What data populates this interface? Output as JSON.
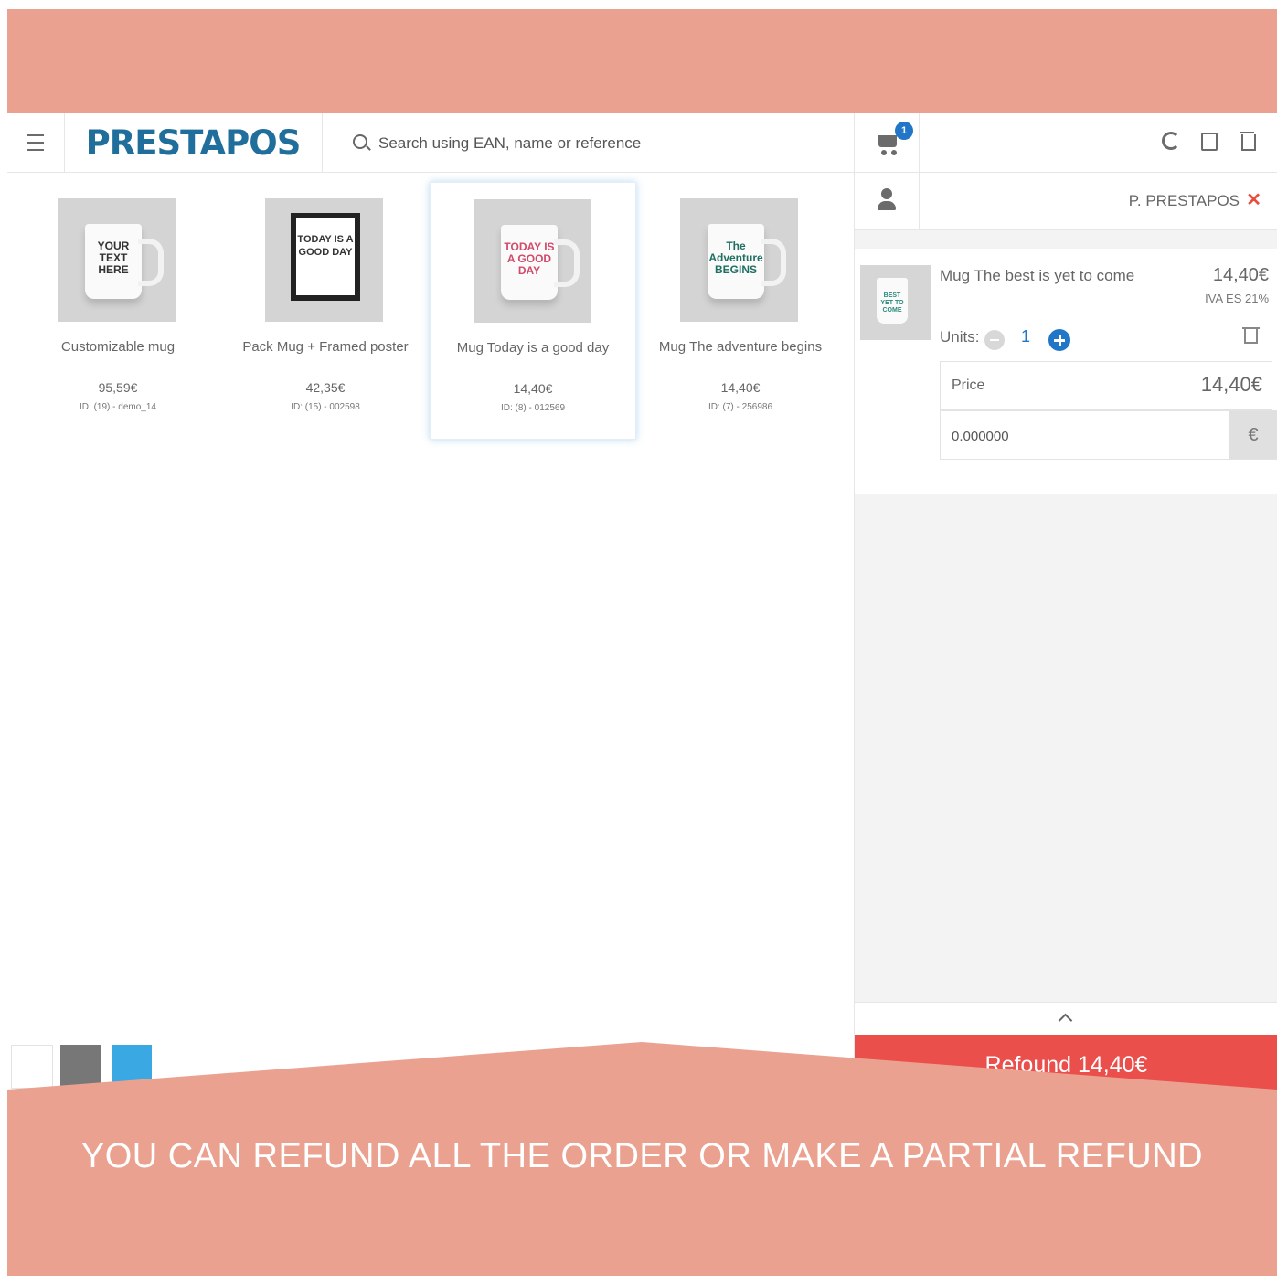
{
  "header": {
    "logo": "PRESTAPOS",
    "search_placeholder": "Search using EAN, name or reference"
  },
  "products": [
    {
      "name": "Customizable mug",
      "price": "95,59€",
      "id": "ID: (19) - demo_14",
      "mug_text": "YOUR TEXT HERE"
    },
    {
      "name": "Pack Mug + Framed poster",
      "price": "42,35€",
      "id": "ID: (15) - 002598",
      "mug_text": "TODAY IS A GOOD DAY"
    },
    {
      "name": "Mug Today is a good day",
      "price": "14,40€",
      "id": "ID: (8) - 012569",
      "mug_text": "TODAY IS A GOOD DAY"
    },
    {
      "name": "Mug The adventure begins",
      "price": "14,40€",
      "id": "ID: (7) - 256986",
      "mug_text": "The Adventure BEGINS"
    }
  ],
  "swatches": [
    {
      "color": "#ffffff"
    },
    {
      "color": "#777777"
    },
    {
      "color": "#3aa8e2"
    }
  ],
  "cart": {
    "badge_count": "1",
    "customer": "P. PRESTAPOS",
    "line": {
      "name": "Mug The best is yet to come",
      "price": "14,40€",
      "tax": "IVA ES 21%",
      "units_label": "Units:",
      "quantity": "1",
      "price_label": "Price",
      "price_value": "14,40€",
      "discount_value": "0.000000",
      "discount_unit": "€",
      "mug_text": "BEST YET TO COME"
    },
    "refund_label": "Refound 14,40€"
  },
  "banner": {
    "caption": "YOU CAN REFUND ALL THE ORDER OR MAKE A PARTIAL REFUND",
    "color": "#eba190"
  }
}
